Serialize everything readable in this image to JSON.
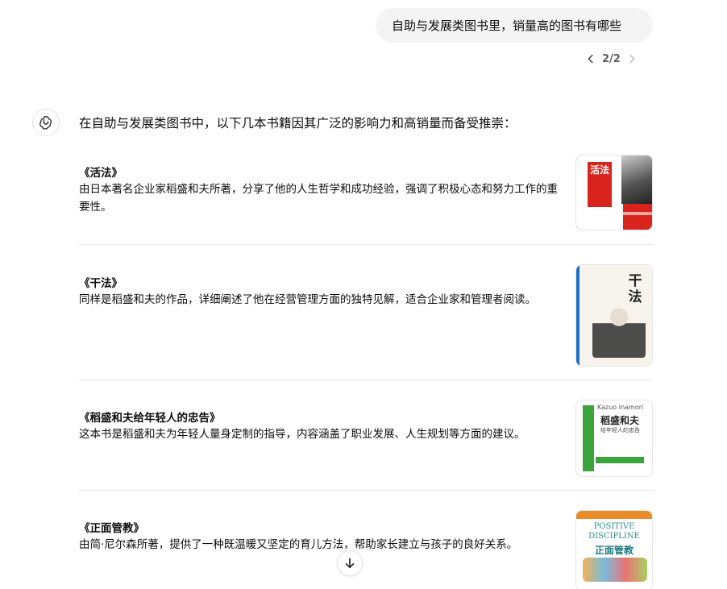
{
  "user_message": {
    "text": "自助与发展类图书里，销量高的图书有哪些"
  },
  "pager": {
    "count": "2/2"
  },
  "assistant": {
    "intro": "在自助与发展类图书中，以下几本书籍因其广泛的影响力和高销量而备受推崇：",
    "books": [
      {
        "title": "《活法》",
        "description": "由日本著名企业家稻盛和夫所著，分享了他的人生哲学和成功经验，强调了积极心态和努力工作的重要性。",
        "cover_text": "活法"
      },
      {
        "title": "《干法》",
        "description": "同样是稻盛和夫的作品，详细阐述了他在经营管理方面的独特见解，适合企业家和管理者阅读。",
        "cover_text": "干法"
      },
      {
        "title": "《稻盛和夫给年轻人的忠告》",
        "description": "这本书是稻盛和夫为年轻人量身定制的指导，内容涵盖了职业发展、人生规划等方面的建议。",
        "cover_en": "Kazuo Inamori",
        "cover_text": "稻盛和夫",
        "cover_sub": "给年轻人的忠告"
      },
      {
        "title": "《正面管教》",
        "description": "由简·尼尔森所著，提供了一种既温暖又坚定的育儿方法，帮助家长建立与孩子的良好关系。",
        "cover_en_line1": "POSITIVE",
        "cover_en_line2": "DISCIPLINE",
        "cover_text": "正面管教"
      }
    ]
  },
  "colors": {
    "bubble_bg": "#f4f4f4",
    "text": "#0d0d0d",
    "divider": "#e6e6e6"
  },
  "icons": {
    "avatar": "openai-logo-icon",
    "prev": "chevron-left-icon",
    "next": "chevron-right-icon",
    "scroll": "arrow-down-icon"
  }
}
